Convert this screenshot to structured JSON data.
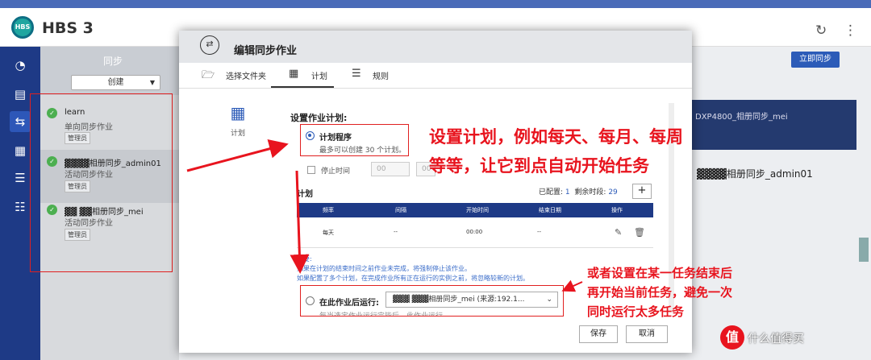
{
  "app": {
    "title": "HBS 3",
    "logo": "HBS"
  },
  "sidebar": {
    "title": "同步",
    "create_label": "创建",
    "jobs": [
      {
        "name": "learn",
        "type": "单向同步作业",
        "tag": "管理员"
      },
      {
        "name": "▓▓▓▓相册同步_admin01",
        "type": "活动同步作业",
        "tag": "管理员"
      },
      {
        "name": "▓▓ ▓▓相册同步_mei",
        "type": "活动同步作业",
        "tag": "管理员"
      }
    ]
  },
  "main": {
    "sync_now_label": "立即同步",
    "device_label": "DXP4800_相册同步_mei",
    "job_title": "▓▓▓▓相册同步_admin01"
  },
  "dialog": {
    "title": "编辑同步作业",
    "tabs": [
      "选择文件夹",
      "计划",
      "规则"
    ],
    "left_label": "计划",
    "section_title": "设置作业计划:",
    "option1_label": "计划程序",
    "option1_hint": "最多可以创建 30 个计划。",
    "stop_label": "停止时间",
    "stop_hour": "00",
    "stop_min": "00",
    "schedule_label": "计划",
    "configured_label": "已配置:",
    "configured_value": "1",
    "remaining_label": "剩余时段:",
    "remaining_value": "29",
    "add_label": "+",
    "table_headers": [
      "频率",
      "间隔",
      "开始时间",
      "结束日期",
      "操作"
    ],
    "row": {
      "freq": "每天",
      "interval": "--",
      "start": "00:00",
      "end": "--"
    },
    "important_label": "重要:",
    "note1": "如果在计划的结束时间之前作业未完成，将强制停止该作业。",
    "note2": "如果配置了多个计划，在完成作业所有正在运行的实例之前，将忽略较新的计划。",
    "option2_label": "在此作业后运行:",
    "option2_value": "▓▓▓ ▓▓▓相册同步_mei (来源:192.1...",
    "option2_hint": "每当选定作业运行完毕后，此作业运行。",
    "save_label": "保存",
    "cancel_label": "取消"
  },
  "annotations": {
    "big_line1": "设置计划，例如每天、每月、每周",
    "big_line2": "等等，让它到点自动开始任务",
    "small_line1": "或者设置在某一任务结束后",
    "small_line2": "再开始当前任务，避免一次",
    "small_line3": "同时运行太多任务"
  },
  "watermark": {
    "logo": "值",
    "text": "什么值得买"
  },
  "colors": {
    "accent": "#2c5bb8",
    "nav": "#1e3a86",
    "annotation": "#e8141e",
    "success": "#4caf50"
  }
}
